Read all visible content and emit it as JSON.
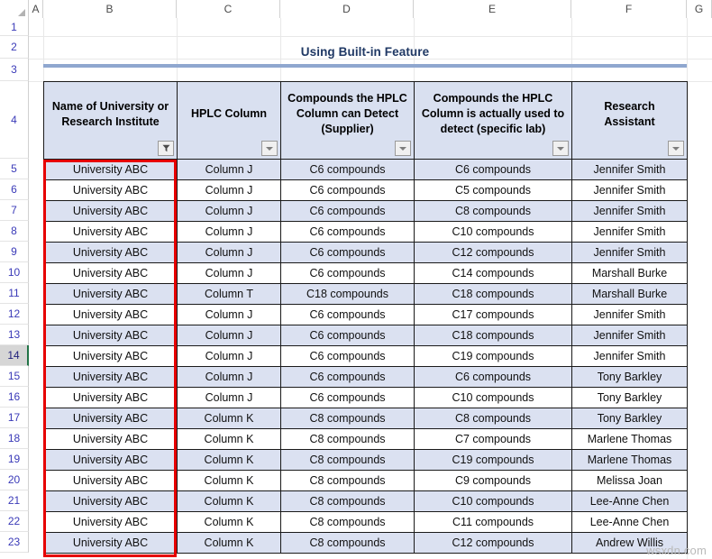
{
  "spreadsheet": {
    "column_headers": [
      "A",
      "B",
      "C",
      "D",
      "E",
      "F",
      "G"
    ],
    "row_numbers": [
      "1",
      "2",
      "3",
      "4",
      "5",
      "6",
      "7",
      "8",
      "9",
      "10",
      "11",
      "12",
      "13",
      "14",
      "15",
      "16",
      "17",
      "18",
      "19",
      "20",
      "21",
      "22",
      "23"
    ],
    "active_row": "14",
    "corner_name": "select-all-corner"
  },
  "title": {
    "text": "Using Built-in Feature",
    "color": "#1F3864",
    "rule_color": "#8FA7CF"
  },
  "table": {
    "headers": [
      {
        "label": "Name of University or Research Institute",
        "filter": "active"
      },
      {
        "label": "HPLC Column",
        "filter": "inactive"
      },
      {
        "label": "Compounds the HPLC Column can Detect (Supplier)",
        "filter": "inactive"
      },
      {
        "label": "Compounds the HPLC Column is actually used to detect (specific lab)",
        "filter": "inactive"
      },
      {
        "label": "Research Assistant",
        "filter": "inactive"
      }
    ],
    "rows": [
      [
        "University ABC",
        "Column J",
        "C6 compounds",
        "C6 compounds",
        "Jennifer Smith"
      ],
      [
        "University ABC",
        "Column J",
        "C6 compounds",
        "C5 compounds",
        "Jennifer Smith"
      ],
      [
        "University ABC",
        "Column J",
        "C6 compounds",
        "C8 compounds",
        "Jennifer Smith"
      ],
      [
        "University ABC",
        "Column J",
        "C6 compounds",
        "C10 compounds",
        "Jennifer Smith"
      ],
      [
        "University ABC",
        "Column J",
        "C6 compounds",
        "C12 compounds",
        "Jennifer Smith"
      ],
      [
        "University ABC",
        "Column J",
        "C6 compounds",
        "C14 compounds",
        "Marshall Burke"
      ],
      [
        "University ABC",
        "Column T",
        "C18 compounds",
        "C18 compounds",
        "Marshall Burke"
      ],
      [
        "University ABC",
        "Column J",
        "C6 compounds",
        "C17 compounds",
        "Jennifer Smith"
      ],
      [
        "University ABC",
        "Column J",
        "C6 compounds",
        "C18 compounds",
        "Jennifer Smith"
      ],
      [
        "University ABC",
        "Column J",
        "C6 compounds",
        "C19 compounds",
        "Jennifer Smith"
      ],
      [
        "University ABC",
        "Column J",
        "C6 compounds",
        "C6 compounds",
        "Tony Barkley"
      ],
      [
        "University ABC",
        "Column J",
        "C6 compounds",
        "C10 compounds",
        "Tony Barkley"
      ],
      [
        "University ABC",
        "Column K",
        "C8 compounds",
        "C8 compounds",
        "Tony Barkley"
      ],
      [
        "University ABC",
        "Column K",
        "C8 compounds",
        "C7 compounds",
        "Marlene Thomas"
      ],
      [
        "University ABC",
        "Column K",
        "C8 compounds",
        "C19 compounds",
        "Marlene Thomas"
      ],
      [
        "University ABC",
        "Column K",
        "C8 compounds",
        "C9 compounds",
        "Melissa Joan"
      ],
      [
        "University ABC",
        "Column K",
        "C8 compounds",
        "C10 compounds",
        "Lee-Anne Chen"
      ],
      [
        "University ABC",
        "Column K",
        "C8 compounds",
        "C11 compounds",
        "Lee-Anne Chen"
      ],
      [
        "University ABC",
        "Column K",
        "C8 compounds",
        "C12 compounds",
        "Andrew Willis"
      ]
    ],
    "header_bg": "#D9E0F0",
    "band_bg": "#DBE1F1",
    "border_color": "#1A1A1A"
  },
  "selection": {
    "name": "column-b-selection",
    "color": "#E60000"
  },
  "watermark": {
    "text": "wsxdn.com"
  }
}
